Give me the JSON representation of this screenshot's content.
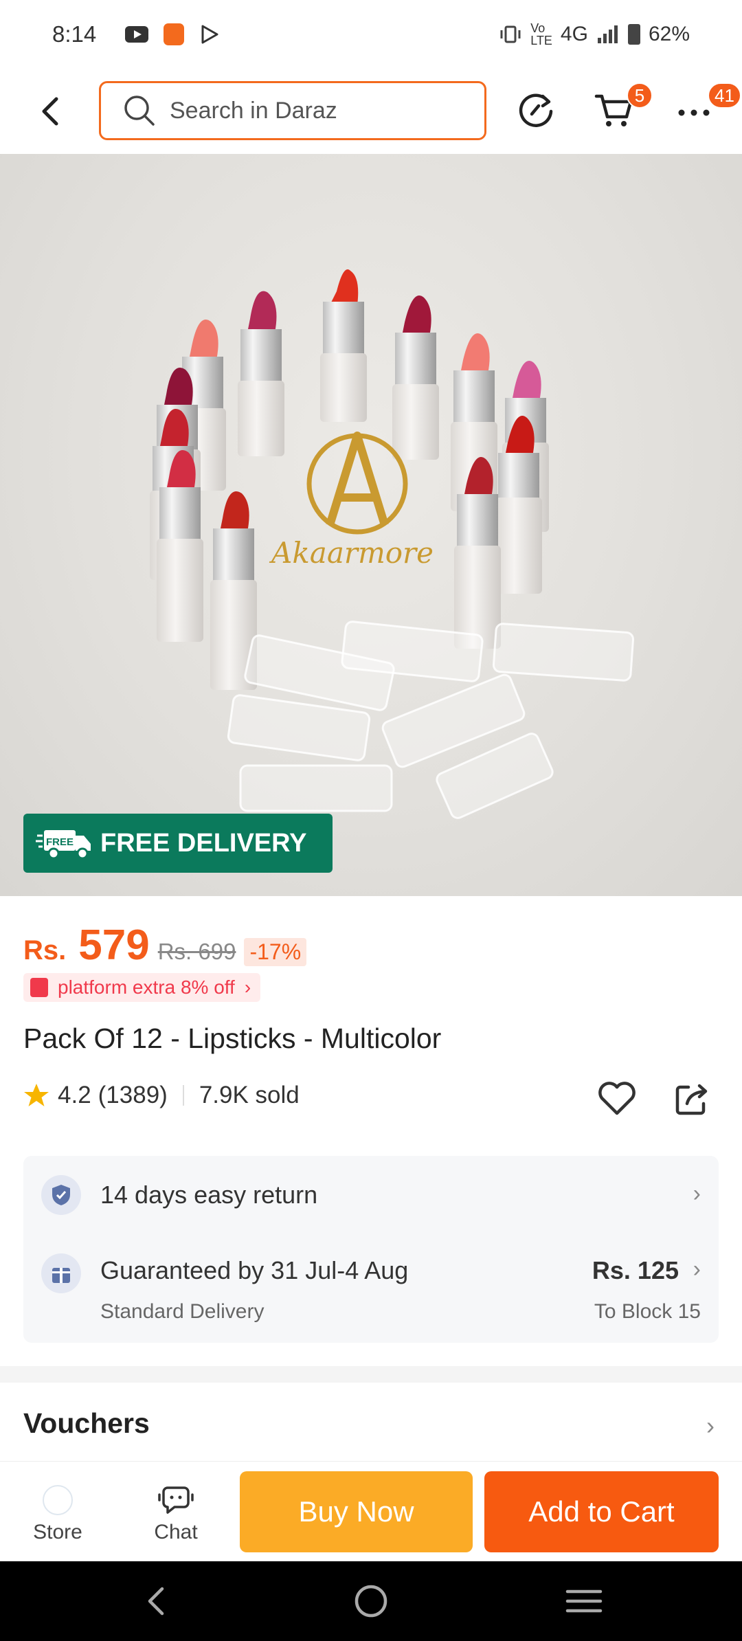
{
  "status_bar": {
    "time": "8:14",
    "network": "4G",
    "battery": "62%"
  },
  "header": {
    "search_placeholder": "Search in Daraz",
    "cart_badge": "5",
    "more_badge": "41"
  },
  "hero": {
    "brand_text": "Akaarmore",
    "free_delivery": "FREE DELIVERY",
    "free_icon_text": "FREE"
  },
  "price": {
    "currency": "Rs.",
    "current": "579",
    "original": "Rs. 699",
    "discount": "-17%",
    "promo": "platform extra 8% off"
  },
  "product": {
    "title": "Pack Of 12 - Lipsticks - Multicolor",
    "rating": "4.2",
    "reviews": "(1389)",
    "sold": "7.9K sold"
  },
  "service": {
    "return": "14 days easy return",
    "delivery": "Guaranteed by 31 Jul-4 Aug",
    "delivery_type": "Standard Delivery",
    "delivery_price": "Rs. 125",
    "delivery_location": "To Block 15"
  },
  "sections": {
    "vouchers": "Vouchers"
  },
  "bottom_bar": {
    "store": "Store",
    "chat": "Chat",
    "buy_now": "Buy Now",
    "add_to_cart": "Add to Cart"
  },
  "colors": {
    "accent": "#f35c1a",
    "buy_now": "#fbab26",
    "add_to_cart": "#f75a10",
    "free_delivery_bg": "#0b7a5c"
  },
  "icons": [
    "back-icon",
    "search-icon",
    "refresh-icon",
    "cart-icon",
    "more-icon",
    "star-icon",
    "heart-icon",
    "share-icon",
    "shield-check-icon",
    "gift-icon",
    "chat-icon",
    "nav-back-icon",
    "nav-home-icon",
    "nav-menu-icon"
  ]
}
